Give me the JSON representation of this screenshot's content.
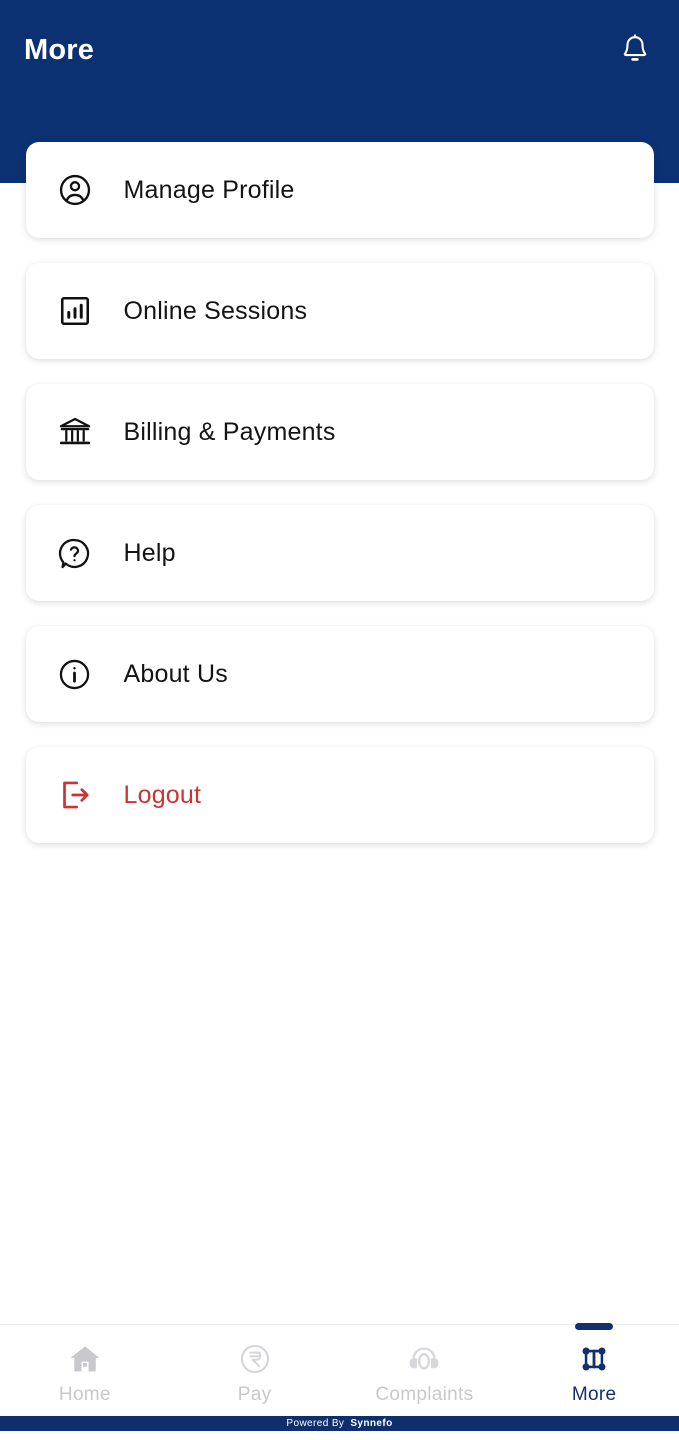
{
  "theme": {
    "header_blue": "#0b3173",
    "footer_blue": "#0e2f6b",
    "active_nav_blue": "#12306e",
    "logout_red": "#cc3333",
    "inactive_nav_gray": "#c9c9cd",
    "card_white": "#ffffff"
  },
  "header": {
    "title": "More",
    "notification_icon": "bell-icon"
  },
  "menu": {
    "items": [
      {
        "label": "Manage Profile",
        "icon": "user-circle-icon",
        "danger": false
      },
      {
        "label": "Online Sessions",
        "icon": "bar-chart-icon",
        "danger": false
      },
      {
        "label": "Billing & Payments",
        "icon": "bank-icon",
        "danger": false
      },
      {
        "label": "Help",
        "icon": "question-help-icon",
        "danger": false
      },
      {
        "label": "About Us",
        "icon": "info-circle-icon",
        "danger": false
      },
      {
        "label": "Logout",
        "icon": "logout-icon",
        "danger": true
      }
    ]
  },
  "bottom_nav": {
    "items": [
      {
        "label": "Home",
        "icon": "home-icon",
        "active": false
      },
      {
        "label": "Pay",
        "icon": "rupee-icon",
        "active": false
      },
      {
        "label": "Complaints",
        "icon": "headset-icon",
        "active": false
      },
      {
        "label": "More",
        "icon": "dashboard-icon",
        "active": true
      }
    ]
  },
  "footer": {
    "powered_by": "Powered By",
    "brand": "Synnefo"
  }
}
